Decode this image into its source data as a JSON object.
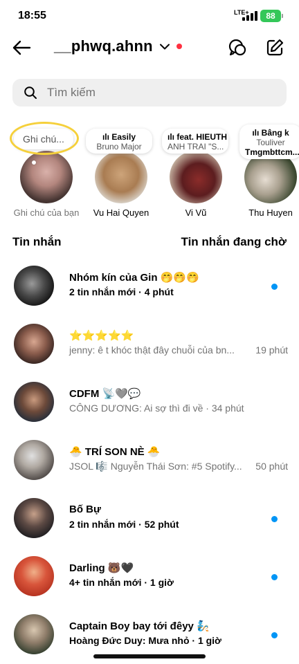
{
  "status": {
    "time": "18:55",
    "network": "LTE+",
    "battery": "88"
  },
  "header": {
    "username": "__phwq.ahnn"
  },
  "search": {
    "placeholder": "Tìm kiếm"
  },
  "notes": [
    {
      "bubble": "Ghi chú...",
      "name": "Ghi chú của bạn"
    },
    {
      "song": "Easily",
      "artist": "Bruno Major",
      "name": "Vu Hai Quyen"
    },
    {
      "song": "feat. HIEUTH",
      "artist": "ANH TRAI \"S...",
      "name": "Vi Vũ"
    },
    {
      "song": "Bâng k",
      "artist": "Touliver",
      "extra": "Tmgmbttcm...",
      "name": "Thu Huyen"
    }
  ],
  "sections": {
    "messages": "Tin nhắn",
    "requests": "Tin nhắn đang chờ"
  },
  "chats": [
    {
      "title": "Nhóm kín của Gin 🤭🤭🤭",
      "sub": "2 tin nhắn mới · 4 phút",
      "time": "",
      "unread": true,
      "bold": true
    },
    {
      "title": "⭐⭐⭐⭐⭐",
      "sub": "jenny: ê t khóc thật đây chuỗi của bn...",
      "time": "19 phút",
      "unread": false,
      "bold": false
    },
    {
      "title": "CDFM 📡🩶💬",
      "sub": "CÔNG DƯƠNG: Ai sợ thì đi về · 34 phút",
      "time": "",
      "unread": false,
      "bold": false
    },
    {
      "title": "🐣 TRÍ SON NÈ 🐣",
      "sub": "JSOL 🎼 Nguyễn Thái Sơn: #5 Spotify...",
      "time": "50 phút",
      "unread": false,
      "bold": false
    },
    {
      "title": "Bố Bự",
      "sub": "2 tin nhắn mới · 52 phút",
      "time": "",
      "unread": true,
      "bold": true
    },
    {
      "title": "Darling 🐻🖤",
      "sub": "4+ tin nhắn mới · 1 giờ",
      "time": "",
      "unread": true,
      "bold": true
    },
    {
      "title": "Captain Boy bay tới đêyy 🧞",
      "sub": "Hoàng Đức Duy: Mưa nhỏ · 1 giờ",
      "time": "",
      "unread": true,
      "bold": true
    }
  ],
  "colors": {
    "accent": "#0095f6",
    "battery": "#34c759",
    "note_ring": "#f5d03b",
    "presence": "#ff3040"
  }
}
